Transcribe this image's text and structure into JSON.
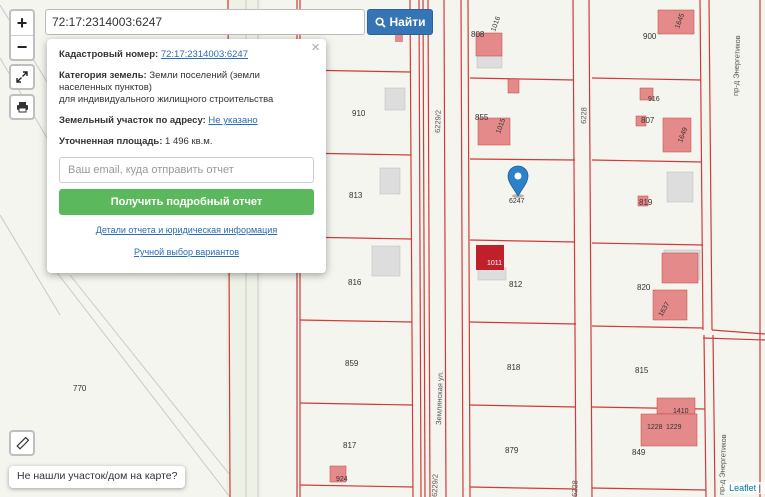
{
  "search": {
    "value": "72:17:2314003:6247",
    "button_label": "Найти"
  },
  "zoom": {
    "in_label": "+",
    "out_label": "−"
  },
  "popup": {
    "close_label": "×",
    "cadastral_label": "Кадастровый номер:",
    "cadastral_value": "72:17:2314003:6247",
    "category_label": "Категория земель:",
    "category_value": "Земли поселений (земли населенных пунктов)",
    "usage_value": "для индивидуального жилищного строительства",
    "address_label": "Земельный участок по адресу:",
    "address_value": "Не указано",
    "area_label": "Уточненная площадь:",
    "area_value": "1 496 кв.м.",
    "email_placeholder": "Ваш email, куда отправить отчет",
    "report_button": "Получить подробный отчет",
    "details_link": "Детали отчета и юридическая информация",
    "manual_link": "Ручной выбор вариантов"
  },
  "not_found_label": "Не нашли участок/дом на карте?",
  "attribution": {
    "leaflet": "Leaflet",
    "separator": "|"
  },
  "map": {
    "parcel_labels": [
      "910",
      "813",
      "816",
      "859",
      "817",
      "924",
      "808",
      "1016",
      "855",
      "1015",
      "6247",
      "1011",
      "812",
      "818",
      "879",
      "900",
      "1645",
      "916",
      "807",
      "1649",
      "819",
      "820",
      "1637",
      "815",
      "1410",
      "1228",
      "1229",
      "849",
      "770"
    ],
    "street_labels": [
      "6229/2",
      "6228",
      "Землянская ул.",
      "пр-д Энергетиков",
      "пр-д Энергетиков"
    ],
    "bottom_labels": [
      "6229/2",
      "6228"
    ],
    "marker_label": "6247"
  }
}
